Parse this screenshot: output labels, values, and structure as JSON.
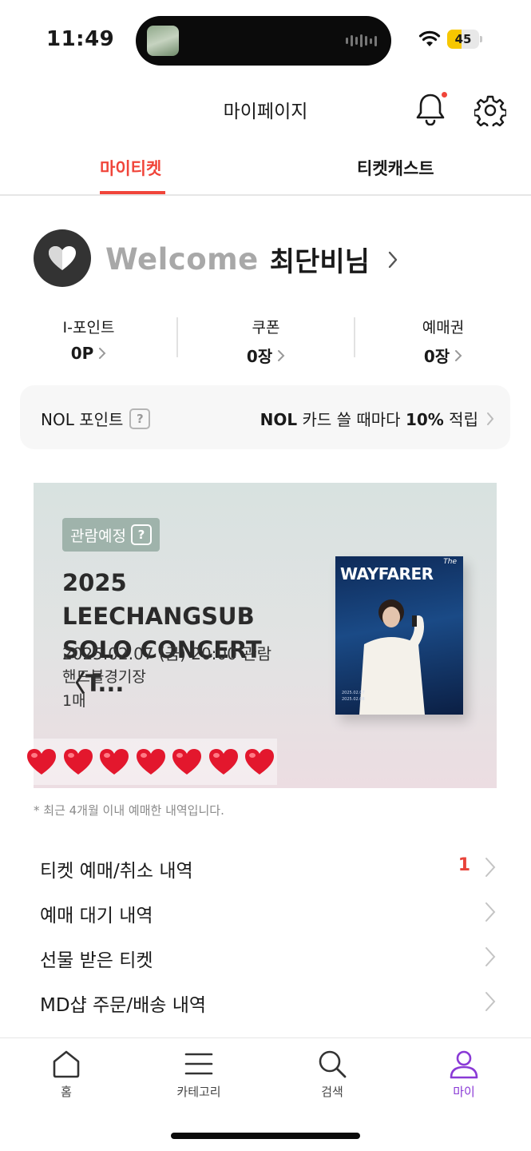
{
  "status_bar": {
    "time": "11:49",
    "battery": "45",
    "battery_level": 0.45
  },
  "header": {
    "title": "마이페이지"
  },
  "tabs": [
    {
      "label": "마이티켓",
      "active": true
    },
    {
      "label": "티켓캐스트",
      "active": false
    }
  ],
  "welcome": {
    "prefix": "Welcome",
    "name": "최단비님"
  },
  "stats": [
    {
      "label": "I-포인트",
      "value": "0P"
    },
    {
      "label": "쿠폰",
      "value": "0장"
    },
    {
      "label": "예매권",
      "value": "0장"
    }
  ],
  "nol": {
    "label": "NOL 포인트",
    "help": "?",
    "promo_bold1": "NOL",
    "promo_mid": " 카드 쓸 때마다 ",
    "promo_bold2": "10%",
    "promo_end": " 적립"
  },
  "ticket": {
    "status": "관람예정",
    "status_help": "?",
    "title_line1": "2025 LEECHANGSUB",
    "title_line2": "SOLO CONCERT 〈T...",
    "date": "2025.02.07 (금)  20:00 관람",
    "venue": "핸드볼경기장",
    "quantity": "1매",
    "poster_word": "WAYFARER",
    "poster_the": "The"
  },
  "note": "* 최근 4개월 이내 예매한 내역입니다.",
  "menu": [
    {
      "label": "티켓 예매/취소 내역",
      "count": "1"
    },
    {
      "label": "예매 대기 내역",
      "count": ""
    },
    {
      "label": "선물 받은 티켓",
      "count": ""
    },
    {
      "label": "MD샵 주문/배송 내역",
      "count": ""
    }
  ],
  "nav": [
    {
      "label": "홈",
      "icon": "home-icon"
    },
    {
      "label": "카테고리",
      "icon": "menu-icon"
    },
    {
      "label": "검색",
      "icon": "search-icon"
    },
    {
      "label": "마이",
      "icon": "user-icon",
      "active": true
    }
  ],
  "colors": {
    "accent": "#f0453a",
    "nav_active": "#8a3ad6",
    "status_pill": "#9fb3ab"
  }
}
